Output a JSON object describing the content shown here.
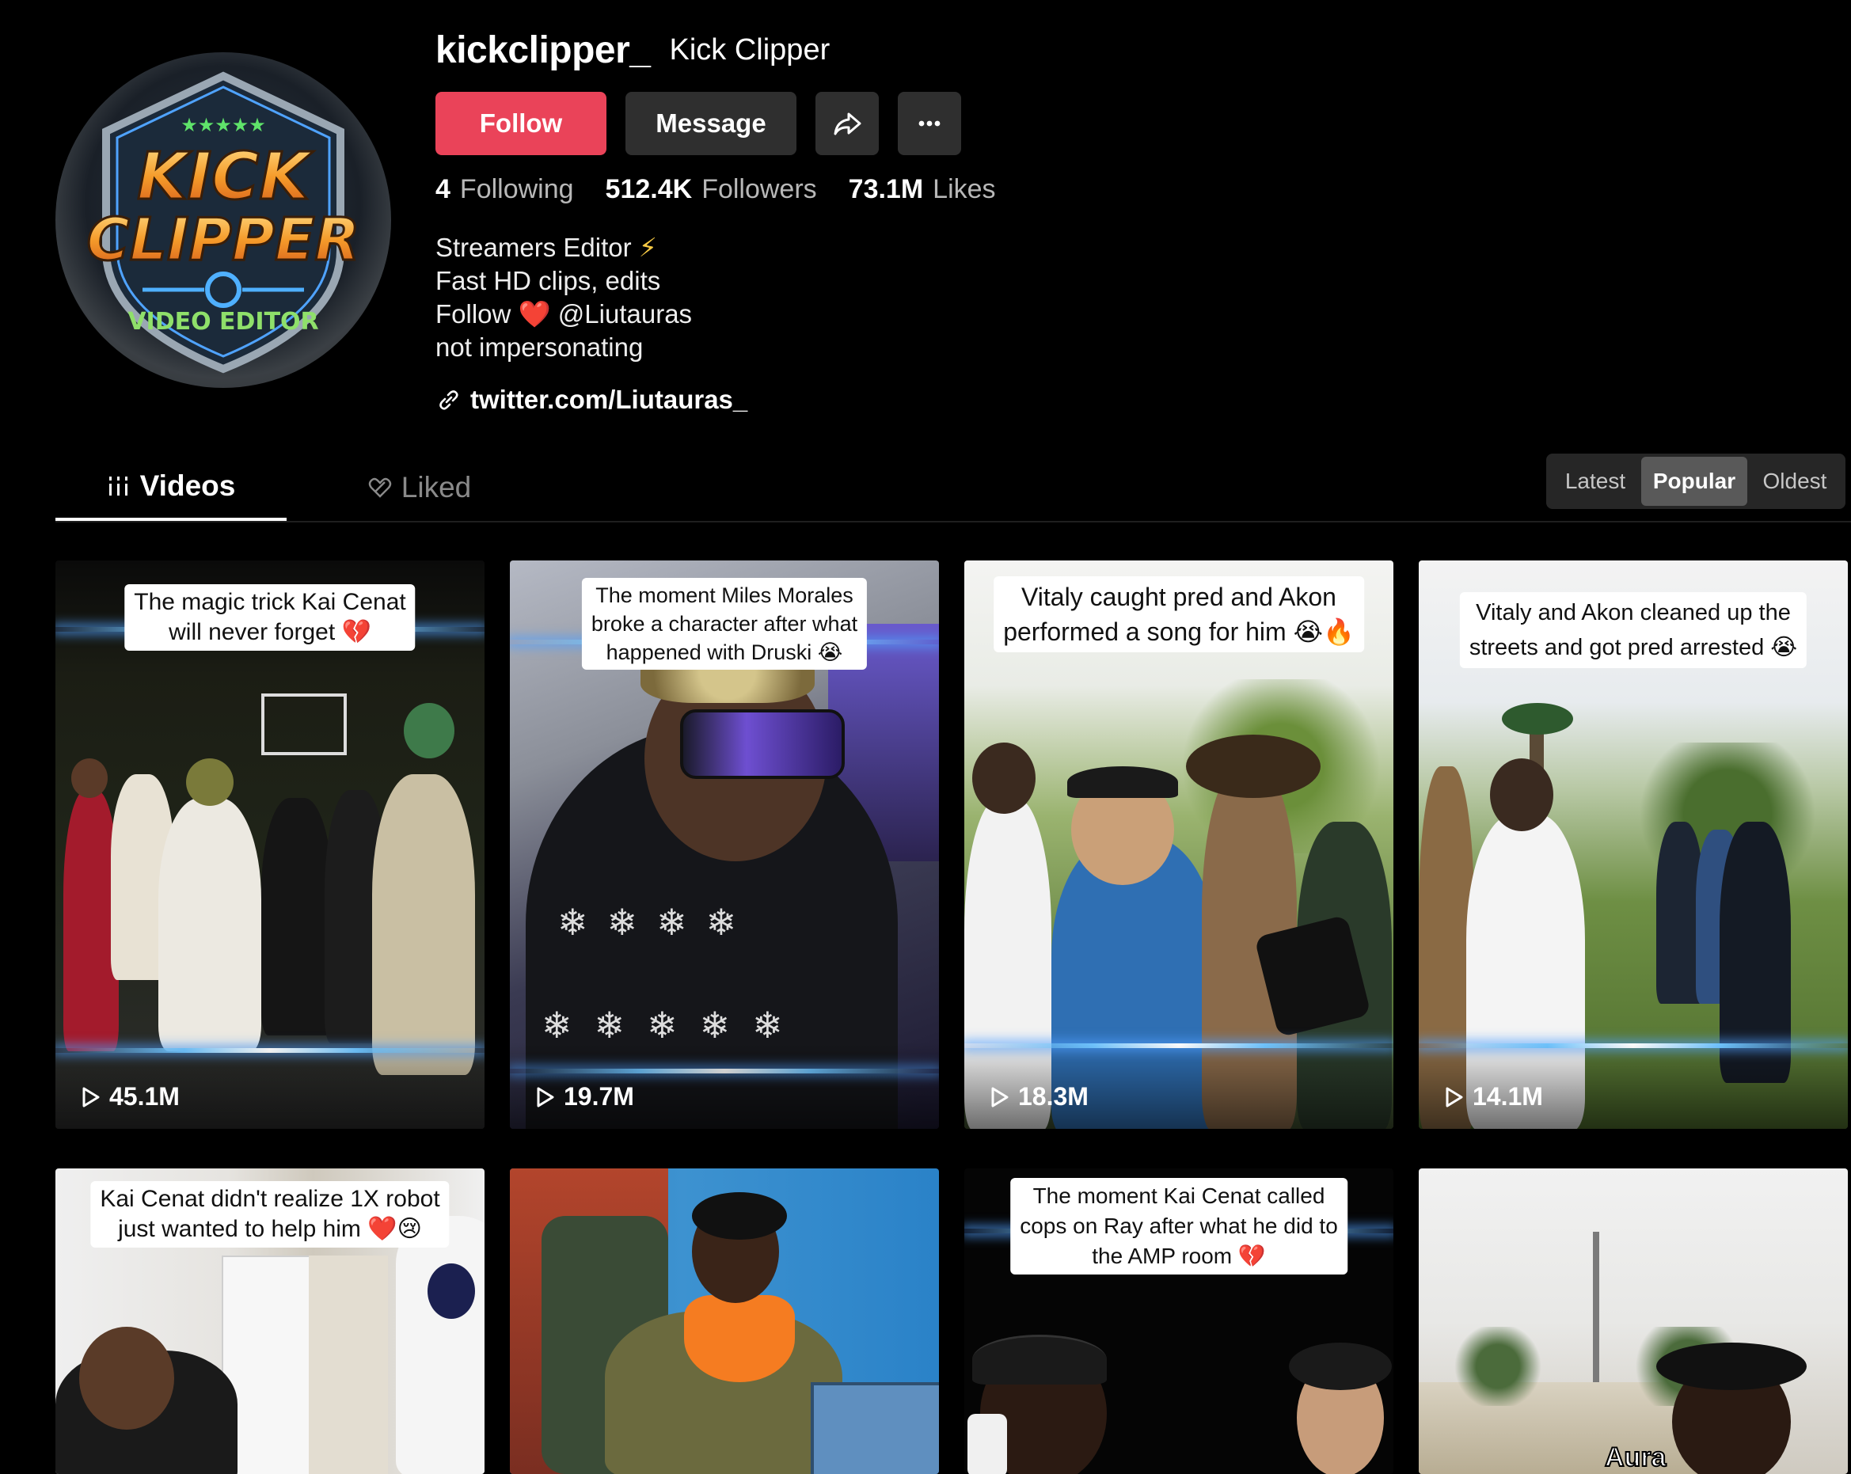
{
  "profile": {
    "username": "kickclipper_",
    "display_name": "Kick Clipper",
    "avatar_text": [
      "KICK",
      "CLIPPER",
      "VIDEO EDITOR"
    ]
  },
  "actions": {
    "follow_label": "Follow",
    "message_label": "Message",
    "share_icon": "share-icon",
    "more_icon": "more-icon"
  },
  "stats": {
    "following_count": "4",
    "following_label": "Following",
    "followers_count": "512.4K",
    "followers_label": "Followers",
    "likes_count": "73.1M",
    "likes_label": "Likes"
  },
  "bio": {
    "line1": "Streamers Editor",
    "line1_emoji": "⚡",
    "line2": "Fast HD clips, edits",
    "line3_prefix": "Follow",
    "line3_emoji": "❤️",
    "line3_handle": "@Liutauras",
    "line4": "not impersonating"
  },
  "link": {
    "text": "twitter.com/Liutauras_",
    "icon": "link-icon"
  },
  "tabs": {
    "videos": "Videos",
    "liked": "Liked"
  },
  "sort": {
    "latest": "Latest",
    "popular": "Popular",
    "oldest": "Oldest",
    "selected": "Popular"
  },
  "videos": [
    {
      "caption_lines": [
        "The magic trick Kai Cenat",
        "will never forget 💔"
      ],
      "views": "45.1M"
    },
    {
      "caption_lines": [
        "The moment Miles Morales",
        "broke a character after what",
        "happened with Druski 😭"
      ],
      "views": "19.7M"
    },
    {
      "caption_lines": [
        "Vitaly caught pred and Akon",
        "performed a song for him 😭🔥"
      ],
      "views": "18.3M"
    },
    {
      "caption_lines": [
        "Vitaly and Akon cleaned up the",
        "streets and got pred arrested 😭"
      ],
      "views": "14.1M"
    },
    {
      "caption_lines": [
        "Kai Cenat didn't realize 1X robot",
        "just wanted to help him ❤️😢"
      ],
      "views": ""
    },
    {
      "caption_lines": [],
      "views": ""
    },
    {
      "caption_lines": [
        "The moment Kai Cenat called",
        "cops on Ray after what he did to",
        "the AMP room 💔"
      ],
      "views": ""
    },
    {
      "caption_lines": [
        "Aura"
      ],
      "views": ""
    }
  ],
  "colors": {
    "follow_button": "#ea4359",
    "background": "#000000",
    "secondary_button": "#2f2f2f"
  }
}
